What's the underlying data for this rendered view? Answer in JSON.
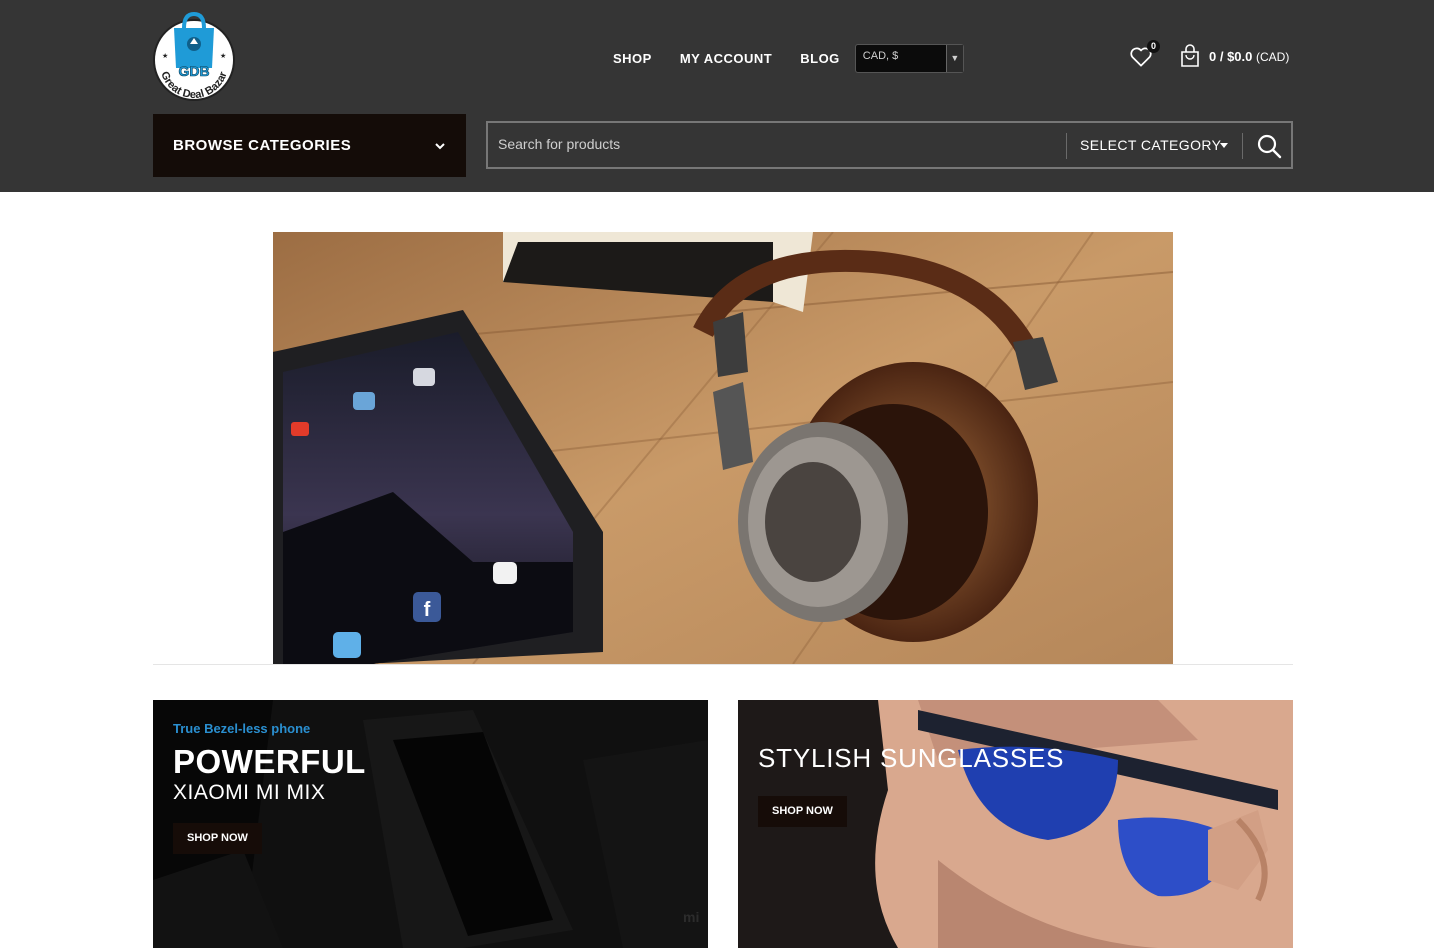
{
  "brand": {
    "logo_initials": "GDB",
    "logo_text": "Great Deal Bazar"
  },
  "nav": {
    "items": [
      "SHOP",
      "MY ACCOUNT",
      "BLOG"
    ],
    "currency_value": "CAD, $"
  },
  "header_icons": {
    "wishlist_icon": "heart-icon",
    "wishlist_count": "0",
    "cart_icon": "shopping-bag-icon",
    "cart_summary": "0 / $0.0",
    "cart_currency": "(CAD)"
  },
  "categories": {
    "label": "BROWSE CATEGORIES",
    "icon": "chevron-down-icon"
  },
  "search": {
    "placeholder": "Search for products",
    "category_label": "SELECT CATEGORY",
    "icon": "search-icon"
  },
  "promos": [
    {
      "subtitle": "True Bezel-less phone",
      "title": "POWERFUL",
      "subtitle2": "XIAOMI MI MIX",
      "button": "SHOP NOW"
    },
    {
      "title": "STYLISH SUNGLASSES",
      "button": "SHOP NOW"
    }
  ],
  "colors": {
    "header_bg": "#353535",
    "browse_bg": "#140c08",
    "accent_blue": "#2a8fd0"
  }
}
